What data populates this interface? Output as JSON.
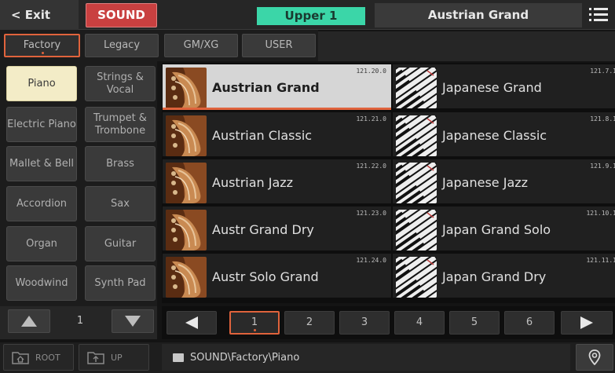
{
  "topbar": {
    "exit_label": "< Exit",
    "mode_label": "SOUND",
    "keyboard_part": "Upper 1",
    "current_sound": "Austrian Grand",
    "menu_icon": "hamburger-icon"
  },
  "bank_tabs": [
    {
      "label": "Factory",
      "active": true
    },
    {
      "label": "Legacy",
      "active": false
    },
    {
      "label": "GM/XG",
      "active": false
    },
    {
      "label": "USER",
      "active": false
    }
  ],
  "categories": [
    {
      "label": "Piano",
      "active": true
    },
    {
      "label": "Strings & Vocal",
      "active": false
    },
    {
      "label": "Electric Piano",
      "active": false
    },
    {
      "label": "Trumpet & Trombone",
      "active": false
    },
    {
      "label": "Mallet & Bell",
      "active": false
    },
    {
      "label": "Brass",
      "active": false
    },
    {
      "label": "Accordion",
      "active": false
    },
    {
      "label": "Sax",
      "active": false
    },
    {
      "label": "Organ",
      "active": false
    },
    {
      "label": "Guitar",
      "active": false
    },
    {
      "label": "Woodwind",
      "active": false
    },
    {
      "label": "Synth Pad",
      "active": false
    }
  ],
  "category_page": {
    "current": "1"
  },
  "sounds": [
    {
      "name": "Austrian Grand",
      "number": "121.20.0",
      "thumb": "acoustic",
      "selected": true
    },
    {
      "name": "Japanese Grand",
      "number": "121.7.1",
      "thumb": "keys",
      "selected": false
    },
    {
      "name": "Austrian Classic",
      "number": "121.21.0",
      "thumb": "acoustic",
      "selected": false
    },
    {
      "name": "Japanese Classic",
      "number": "121.8.1",
      "thumb": "keys",
      "selected": false
    },
    {
      "name": "Austrian Jazz",
      "number": "121.22.0",
      "thumb": "acoustic",
      "selected": false
    },
    {
      "name": "Japanese Jazz",
      "number": "121.9.1",
      "thumb": "keys",
      "selected": false
    },
    {
      "name": "Austr Grand Dry",
      "number": "121.23.0",
      "thumb": "acoustic",
      "selected": false
    },
    {
      "name": "Japan Grand Solo",
      "number": "121.10.1",
      "thumb": "keys",
      "selected": false
    },
    {
      "name": "Austr Solo Grand",
      "number": "121.24.0",
      "thumb": "acoustic",
      "selected": false
    },
    {
      "name": "Japan Grand Dry",
      "number": "121.11.1",
      "thumb": "keys",
      "selected": false
    }
  ],
  "pages": [
    {
      "label": "1",
      "active": true
    },
    {
      "label": "2",
      "active": false
    },
    {
      "label": "3",
      "active": false
    },
    {
      "label": "4",
      "active": false
    },
    {
      "label": "5",
      "active": false
    },
    {
      "label": "6",
      "active": false
    }
  ],
  "footer": {
    "root_label": "ROOT",
    "up_label": "UP",
    "path": "SOUND\\Factory\\Piano",
    "location_icon": "location-pin-icon"
  },
  "colors": {
    "accent": "#e0633c",
    "mode_red": "#c94040",
    "part_green": "#3bd6a8",
    "category_active": "#f3ecc7"
  }
}
